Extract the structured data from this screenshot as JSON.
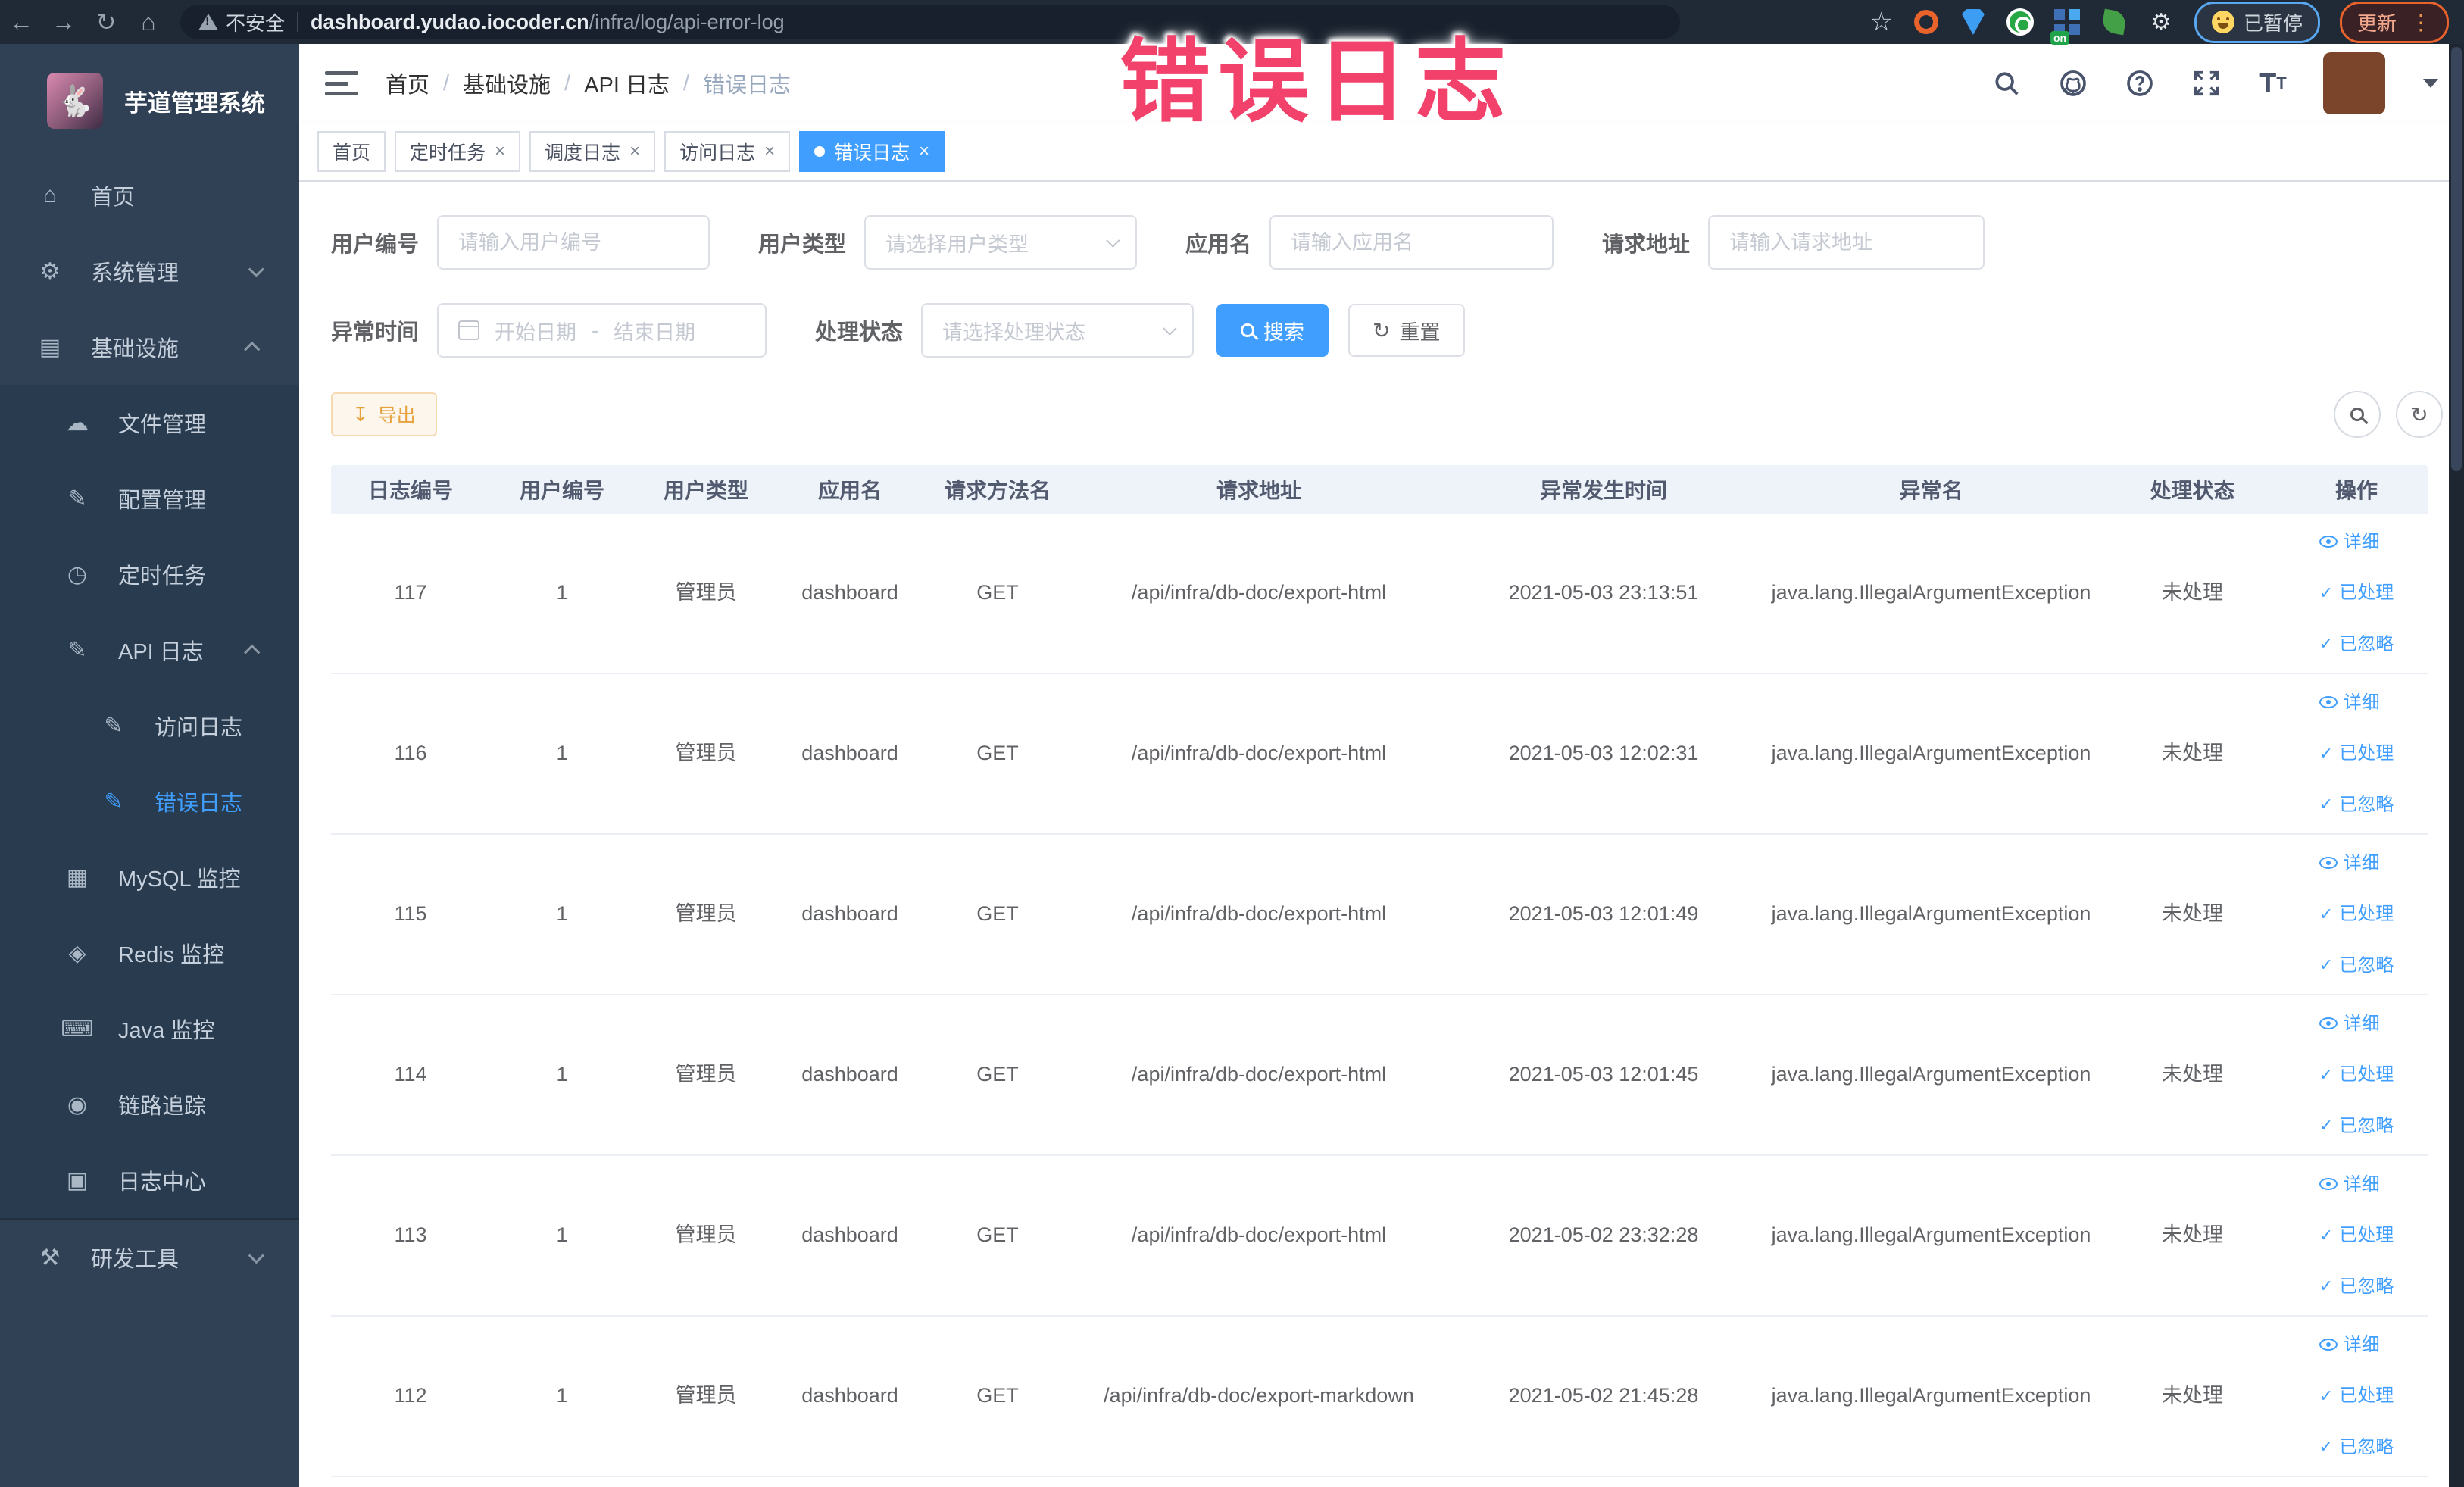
{
  "annotation": {
    "text": "错误日志",
    "color": "#f2426b"
  },
  "browser": {
    "security_label": "不安全",
    "url_host": "dashboard.yudao.iocoder.cn",
    "url_path": "/infra/log/api-error-log",
    "paused_label": "已暂停",
    "update_label": "更新",
    "nav_icons": [
      "back",
      "forward",
      "reload",
      "home"
    ],
    "extension_icons": [
      "orange-ring",
      "blue-shield",
      "green-ring",
      "grid-on",
      "green-leaf",
      "puzzle"
    ]
  },
  "sidebar": {
    "title": "芋道管理系统",
    "logo_icon": "rabbit",
    "menu": [
      {
        "label": "首页",
        "icon": "home",
        "level": 1
      },
      {
        "label": "系统管理",
        "icon": "gear",
        "level": 1,
        "chevron": "down"
      },
      {
        "label": "基础设施",
        "icon": "monitor",
        "level": 1,
        "chevron": "up"
      },
      {
        "label": "文件管理",
        "icon": "cloud",
        "level": 2
      },
      {
        "label": "配置管理",
        "icon": "edit",
        "level": 2
      },
      {
        "label": "定时任务",
        "icon": "timer",
        "level": 2
      },
      {
        "label": "API 日志",
        "icon": "log",
        "level": 2,
        "chevron": "up"
      },
      {
        "label": "访问日志",
        "icon": "log",
        "level": 3
      },
      {
        "label": "错误日志",
        "icon": "log",
        "level": 3,
        "active": true
      },
      {
        "label": "MySQL 监控",
        "icon": "mysql",
        "level": 2
      },
      {
        "label": "Redis 监控",
        "icon": "redis",
        "level": 2
      },
      {
        "label": "Java 监控",
        "icon": "java",
        "level": 2
      },
      {
        "label": "链路追踪",
        "icon": "trace",
        "level": 2
      },
      {
        "label": "日志中心",
        "icon": "logcenter",
        "level": 2
      },
      {
        "label": "研发工具",
        "icon": "tools",
        "level": 1,
        "chevron": "down",
        "divider_before": true
      }
    ]
  },
  "header": {
    "breadcrumb": [
      "首页",
      "基础设施",
      "API 日志",
      "错误日志"
    ],
    "icons": [
      "search",
      "github",
      "help",
      "fullscreen",
      "font-size"
    ]
  },
  "tabs": [
    {
      "label": "首页",
      "closable": false,
      "active": false
    },
    {
      "label": "定时任务",
      "closable": true,
      "active": false
    },
    {
      "label": "调度日志",
      "closable": true,
      "active": false
    },
    {
      "label": "访问日志",
      "closable": true,
      "active": false
    },
    {
      "label": "错误日志",
      "closable": true,
      "active": true
    }
  ],
  "filters": {
    "user_id_label": "用户编号",
    "user_id_placeholder": "请输入用户编号",
    "user_type_label": "用户类型",
    "user_type_placeholder": "请选择用户类型",
    "app_name_label": "应用名",
    "app_name_placeholder": "请输入应用名",
    "request_url_label": "请求地址",
    "request_url_placeholder": "请输入请求地址",
    "exception_time_label": "异常时间",
    "date_start_placeholder": "开始日期",
    "date_separator": "-",
    "date_end_placeholder": "结束日期",
    "process_status_label": "处理状态",
    "process_status_placeholder": "请选择处理状态",
    "search_label": "搜索",
    "reset_label": "重置"
  },
  "toolbar": {
    "export_label": "导出"
  },
  "table": {
    "columns": [
      "日志编号",
      "用户编号",
      "用户类型",
      "应用名",
      "请求方法名",
      "请求地址",
      "异常发生时间",
      "异常名",
      "处理状态",
      "操作"
    ],
    "actions": [
      "详细",
      "已处理",
      "已忽略"
    ],
    "rows": [
      {
        "id": "117",
        "user_id": "1",
        "user_type": "管理员",
        "app": "dashboard",
        "method": "GET",
        "url": "/api/infra/db-doc/export-html",
        "time": "2021-05-03 23:13:51",
        "exception": "java.lang.IllegalArgumentException",
        "status": "未处理"
      },
      {
        "id": "116",
        "user_id": "1",
        "user_type": "管理员",
        "app": "dashboard",
        "method": "GET",
        "url": "/api/infra/db-doc/export-html",
        "time": "2021-05-03 12:02:31",
        "exception": "java.lang.IllegalArgumentException",
        "status": "未处理"
      },
      {
        "id": "115",
        "user_id": "1",
        "user_type": "管理员",
        "app": "dashboard",
        "method": "GET",
        "url": "/api/infra/db-doc/export-html",
        "time": "2021-05-03 12:01:49",
        "exception": "java.lang.IllegalArgumentException",
        "status": "未处理"
      },
      {
        "id": "114",
        "user_id": "1",
        "user_type": "管理员",
        "app": "dashboard",
        "method": "GET",
        "url": "/api/infra/db-doc/export-html",
        "time": "2021-05-03 12:01:45",
        "exception": "java.lang.IllegalArgumentException",
        "status": "未处理"
      },
      {
        "id": "113",
        "user_id": "1",
        "user_type": "管理员",
        "app": "dashboard",
        "method": "GET",
        "url": "/api/infra/db-doc/export-html",
        "time": "2021-05-02 23:32:28",
        "exception": "java.lang.IllegalArgumentException",
        "status": "未处理"
      },
      {
        "id": "112",
        "user_id": "1",
        "user_type": "管理员",
        "app": "dashboard",
        "method": "GET",
        "url": "/api/infra/db-doc/export-markdown",
        "time": "2021-05-02 21:45:28",
        "exception": "java.lang.IllegalArgumentException",
        "status": "未处理"
      }
    ]
  },
  "colors": {
    "accent_blue": "#409eff",
    "warning_orange": "#e6a23c",
    "sidebar_bg": "#304156",
    "annotation_pink": "#f2426b"
  }
}
